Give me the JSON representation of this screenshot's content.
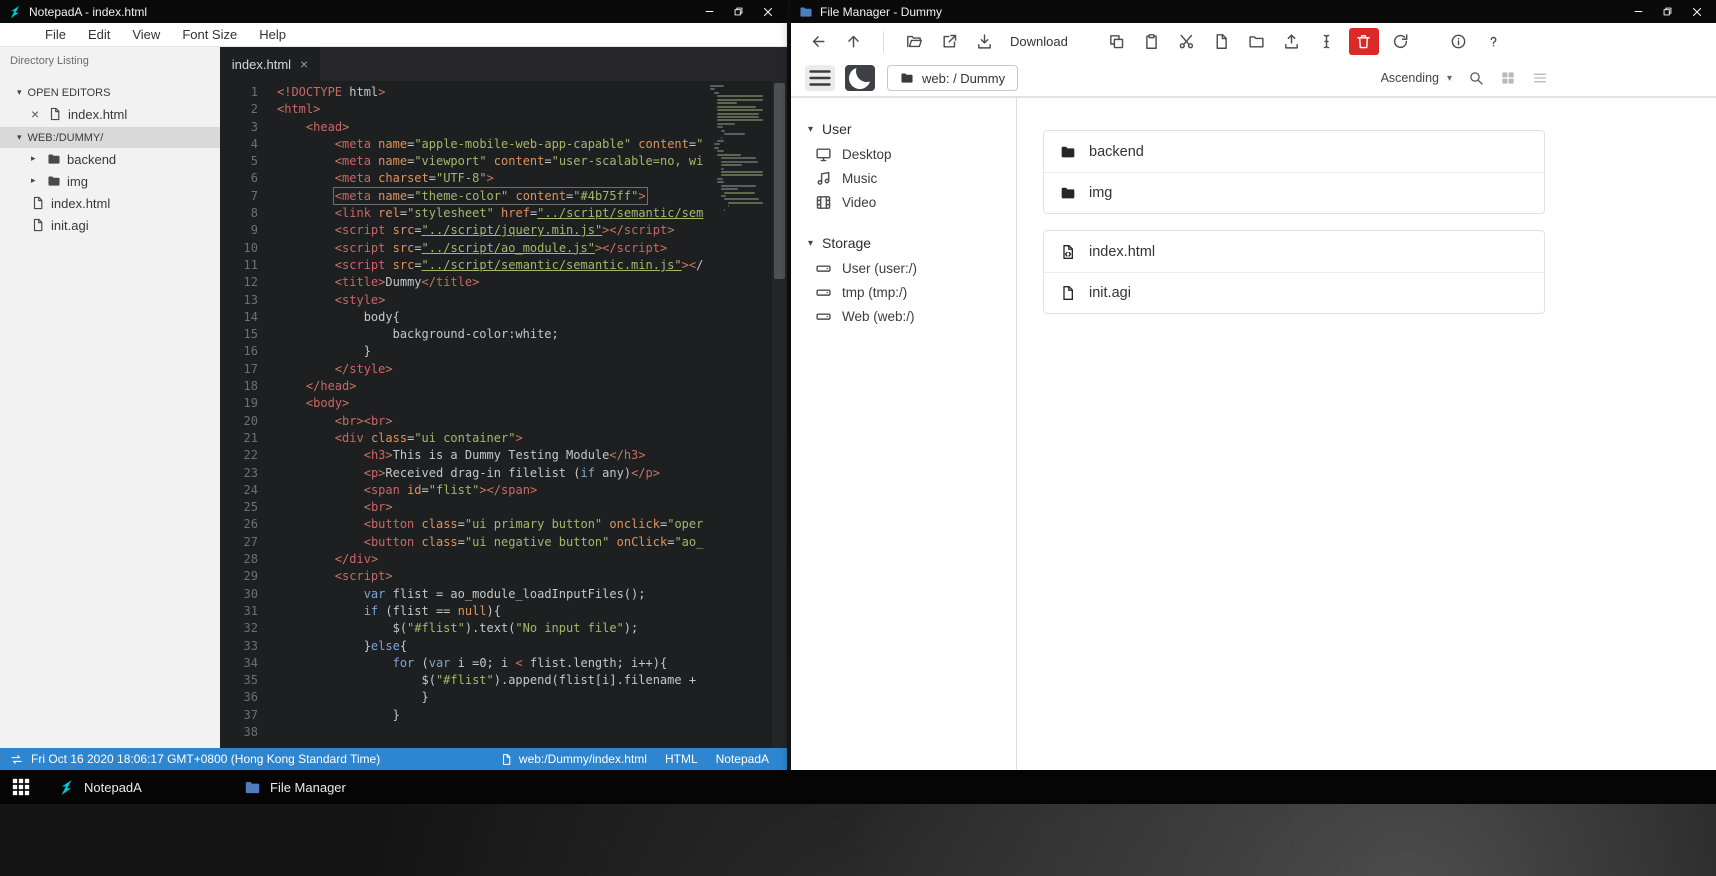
{
  "colors": {
    "statusbar_blue": "#2e86d1",
    "danger_red": "#db2828",
    "logo_teal": "#00c8dc",
    "folder_blue": "#4d7cc0"
  },
  "notepada": {
    "window_title": "NotepadA - index.html",
    "window_controls": [
      "minimize",
      "restore",
      "close"
    ],
    "menu": [
      {
        "label": "File"
      },
      {
        "label": "Edit"
      },
      {
        "label": "View"
      },
      {
        "label": "Font Size"
      },
      {
        "label": "Help"
      }
    ],
    "sidebar": {
      "header": "Directory Listing",
      "sections": [
        {
          "label": "OPEN EDITORS",
          "expanded": true,
          "items": [
            {
              "name": "index.html",
              "icon": "file",
              "closable": true
            }
          ]
        },
        {
          "label": "WEB:/DUMMY/",
          "expanded": true,
          "highlight": true,
          "items": [
            {
              "name": "backend",
              "icon": "folder",
              "expandable": true
            },
            {
              "name": "img",
              "icon": "folder",
              "expandable": true
            },
            {
              "name": "index.html",
              "icon": "file"
            },
            {
              "name": "init.agi",
              "icon": "file"
            }
          ]
        }
      ]
    },
    "tab": {
      "name": "index.html"
    },
    "editor": {
      "active_line": 7,
      "lines": [
        "<!DOCTYPE html>",
        "<html>",
        "    <head>",
        "        <meta name=\"apple-mobile-web-app-capable\" content=\"",
        "        <meta name=\"viewport\" content=\"user-scalable=no, wi",
        "        <meta charset=\"UTF-8\">",
        "        <meta name=\"theme-color\" content=\"#4b75ff\">",
        "        <link rel=\"stylesheet\" href=\"../script/semantic/sem",
        "        <script src=\"../script/jquery.min.js\"></script>",
        "        <script src=\"../script/ao_module.js\"></script>",
        "        <script src=\"../script/semantic/semantic.min.js\"></",
        "        <title>Dummy</title>",
        "        <style>",
        "            body{",
        "                background-color:white;",
        "            }",
        "        </style>",
        "    </head>",
        "    <body>",
        "        <br><br>",
        "        <div class=\"ui container\">",
        "            <h3>This is a Dummy Testing Module</h3>",
        "            <p>Received drag-in filelist (if any)</p>",
        "            <span id=\"flist\"></span>",
        "            <br>",
        "            <button class=\"ui primary button\" onclick=\"oper",
        "            <button class=\"ui negative button\" onClick=\"ao_",
        "        </div>",
        "        <script>",
        "            var flist = ao_module_loadInputFiles();",
        "            if (flist == null){",
        "                $(\"#flist\").text(\"No input file\");",
        "            }else{",
        "                for (var i =0; i < flist.length; i++){",
        "                    $(\"#flist\").append(flist[i].filename + ",
        "                    }",
        "                }",
        ""
      ]
    },
    "statusbar": {
      "left": "Fri Oct 16 2020 18:06:17 GMT+0800 (Hong Kong Standard Time)",
      "file_path": "web:/Dummy/index.html",
      "language": "HTML",
      "app": "NotepadA"
    }
  },
  "filemanager": {
    "window_title": "File Manager - Dummy",
    "window_controls": [
      "minimize",
      "restore",
      "close"
    ],
    "toolbar": [
      {
        "type": "button",
        "icon": "arrow-left",
        "name": "back"
      },
      {
        "type": "button",
        "icon": "arrow-up",
        "name": "up"
      },
      {
        "type": "sep"
      },
      {
        "type": "button",
        "icon": "folder-open",
        "name": "open"
      },
      {
        "type": "button",
        "icon": "external-link",
        "name": "open-in-new"
      },
      {
        "type": "button",
        "icon": "download",
        "name": "download"
      },
      {
        "type": "label",
        "label": "Download",
        "name": "download-label"
      },
      {
        "type": "gap"
      },
      {
        "type": "button",
        "icon": "copy",
        "name": "copy"
      },
      {
        "type": "button",
        "icon": "paste",
        "name": "paste"
      },
      {
        "type": "button",
        "icon": "scissors",
        "name": "cut"
      },
      {
        "type": "button",
        "icon": "file",
        "name": "new-file"
      },
      {
        "type": "button",
        "icon": "folder-outline",
        "name": "new-folder"
      },
      {
        "type": "button",
        "icon": "upload",
        "name": "upload"
      },
      {
        "type": "button",
        "icon": "text-cursor",
        "name": "rename"
      },
      {
        "type": "button",
        "icon": "trash",
        "name": "delete",
        "danger": true
      },
      {
        "type": "button",
        "icon": "refresh",
        "name": "refresh"
      },
      {
        "type": "gap"
      },
      {
        "type": "button",
        "icon": "info",
        "name": "properties"
      },
      {
        "type": "button",
        "icon": "help",
        "name": "help"
      }
    ],
    "breadcrumb": "web: / Dummy",
    "sort_label": "Ascending",
    "sidebar": {
      "sections": [
        {
          "label": "User",
          "expanded": true,
          "items": [
            {
              "name": "Desktop",
              "icon": "desktop"
            },
            {
              "name": "Music",
              "icon": "music"
            },
            {
              "name": "Video",
              "icon": "film"
            }
          ]
        },
        {
          "label": "Storage",
          "expanded": true,
          "items": [
            {
              "name": "User (user:/)",
              "icon": "drive"
            },
            {
              "name": "tmp (tmp:/)",
              "icon": "drive"
            },
            {
              "name": "Web (web:/)",
              "icon": "drive"
            }
          ]
        }
      ]
    },
    "listing": [
      {
        "group": [
          {
            "name": "backend",
            "icon": "folder"
          },
          {
            "name": "img",
            "icon": "folder"
          }
        ]
      },
      {
        "group": [
          {
            "name": "index.html",
            "icon": "file-code"
          },
          {
            "name": "init.agi",
            "icon": "file"
          }
        ]
      }
    ]
  },
  "taskbar": {
    "items": [
      {
        "label": "NotepadA",
        "icon": "notepada-logo"
      },
      {
        "label": "File Manager",
        "icon": "folder"
      }
    ]
  }
}
